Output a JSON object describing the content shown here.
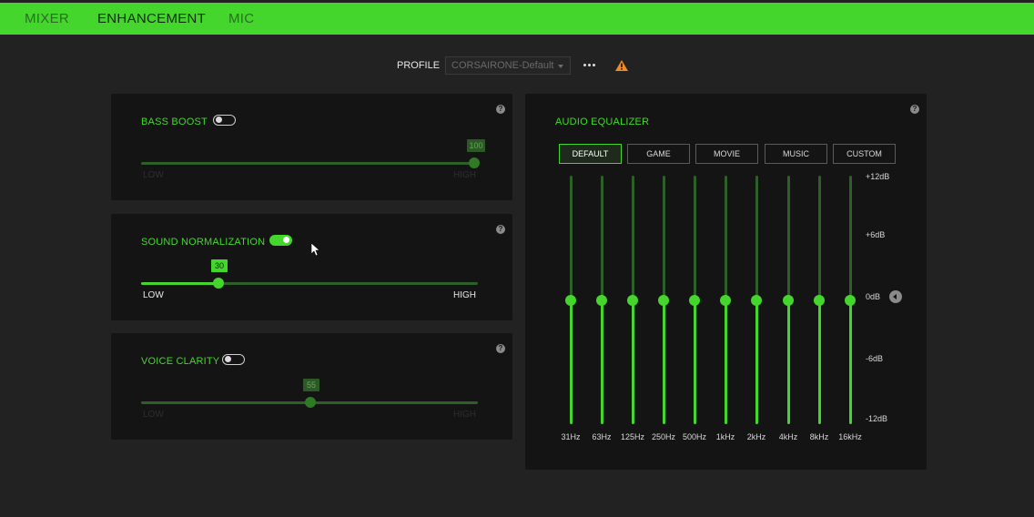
{
  "nav": {
    "tabs": [
      {
        "label": "MIXER",
        "active": false
      },
      {
        "label": "ENHANCEMENT",
        "active": true
      },
      {
        "label": "MIC",
        "active": false
      }
    ]
  },
  "profile": {
    "label": "PROFILE",
    "selected": "CORSAIRONE-Default",
    "more_icon": "more-horizontal-icon",
    "warning_icon": "warning-triangle-icon"
  },
  "bass_boost": {
    "title": "BASS BOOST",
    "enabled": false,
    "value": "100",
    "value_fraction": 1.0,
    "low_label": "LOW",
    "high_label": "HIGH"
  },
  "sound_normalization": {
    "title": "SOUND NORMALIZATION",
    "enabled": true,
    "value": "30",
    "value_fraction": 0.23,
    "low_label": "LOW",
    "high_label": "HIGH"
  },
  "voice_clarity": {
    "title": "VOICE CLARITY",
    "enabled": false,
    "value": "55",
    "value_fraction": 0.5,
    "low_label": "LOW",
    "high_label": "HIGH"
  },
  "equalizer": {
    "title": "AUDIO EQUALIZER",
    "presets": [
      {
        "label": "DEFAULT",
        "active": true
      },
      {
        "label": "GAME",
        "active": false
      },
      {
        "label": "MOVIE",
        "active": false
      },
      {
        "label": "MUSIC",
        "active": false
      },
      {
        "label": "CUSTOM",
        "active": false
      }
    ],
    "db_scale": [
      "+12dB",
      "+6dB",
      "0dB",
      "-6dB",
      "-12dB"
    ],
    "bands": [
      {
        "freq": "31Hz",
        "gain_db": 0
      },
      {
        "freq": "63Hz",
        "gain_db": 0
      },
      {
        "freq": "125Hz",
        "gain_db": 0
      },
      {
        "freq": "250Hz",
        "gain_db": 0
      },
      {
        "freq": "500Hz",
        "gain_db": 0
      },
      {
        "freq": "1kHz",
        "gain_db": 0
      },
      {
        "freq": "2kHz",
        "gain_db": 0
      },
      {
        "freq": "4kHz",
        "gain_db": 0
      },
      {
        "freq": "8kHz",
        "gain_db": 0
      },
      {
        "freq": "16kHz",
        "gain_db": 0
      }
    ]
  },
  "help_glyph": "?",
  "colors": {
    "accent": "#44d62c",
    "accent_dim": "#2f5f28",
    "panel": "#141414",
    "background": "#222222",
    "warning": "#f08a24"
  }
}
